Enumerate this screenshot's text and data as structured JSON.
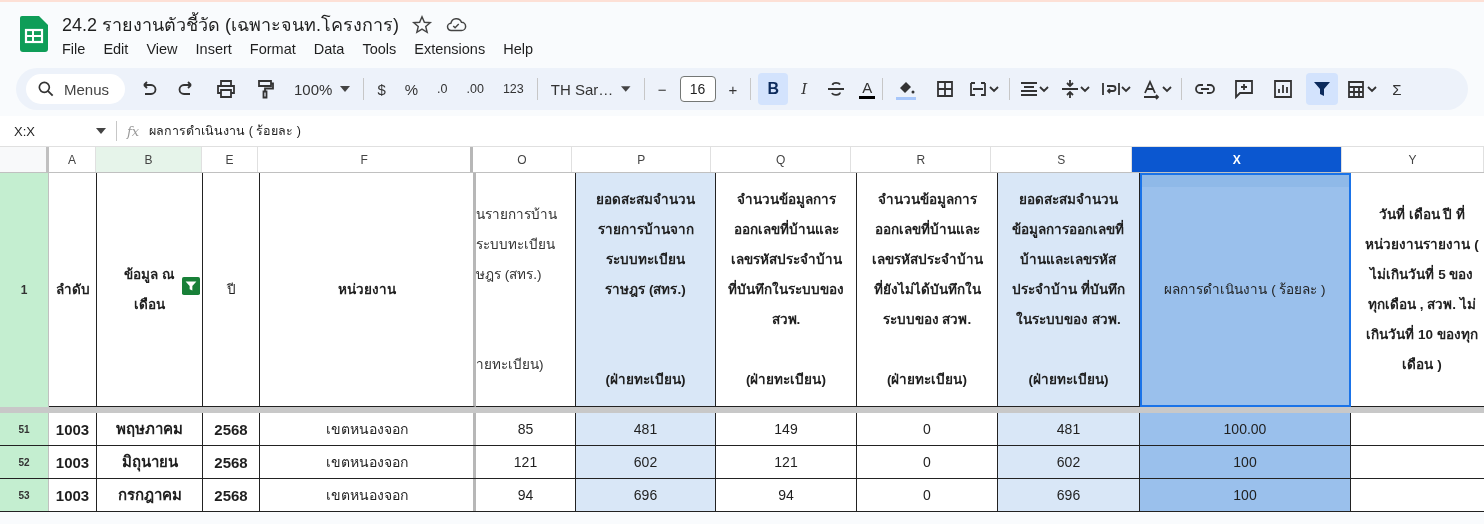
{
  "document": {
    "title": "24.2 รายงานตัวชี้วัด (เฉพาะจนท.โครงการ)",
    "starred": false
  },
  "menu": [
    "File",
    "Edit",
    "View",
    "Insert",
    "Format",
    "Data",
    "Tools",
    "Extensions",
    "Help"
  ],
  "toolbar": {
    "search_placeholder": "Menus",
    "zoom": "100%",
    "currency": "$",
    "percent": "%",
    "decimal_decrease": ".0",
    "decimal_increase": ".00",
    "number_format": "123",
    "font": "TH Sar…",
    "font_size": "16",
    "minus": "−",
    "plus": "+",
    "bold": {
      "label": "B",
      "on": true
    },
    "italic": {
      "label": "I"
    },
    "text_color": {
      "label": "A",
      "color": "#000000"
    },
    "fill_color": {
      "color": "#a8c7fa"
    },
    "filter_on": true,
    "sum": "Σ"
  },
  "formula_bar": {
    "name_box": "X:X",
    "fx": "fx",
    "value": "ผลการดำเนินงาน ( ร้อยละ )"
  },
  "columns": [
    {
      "letter": "A",
      "header": "ลำดับ",
      "bold": true,
      "selected": false,
      "highlighted": false,
      "filtered": false
    },
    {
      "letter": "B",
      "header": "ข้อมูล ณ\nเดือน",
      "bold": true,
      "selected": false,
      "highlighted": false,
      "filtered": true
    },
    {
      "letter": "E",
      "header": "ปี",
      "bold": false,
      "selected": false,
      "highlighted": false,
      "filtered": false
    },
    {
      "letter": "F",
      "header": "หน่วยงาน",
      "bold": true,
      "selected": false,
      "highlighted": false,
      "filtered": false
    },
    {
      "letter": "O",
      "header": "นรายการบ้าน\nระบบทะเบียน\nษฎร (สทร.)\n\n\nายทะเบียน)",
      "bold": false,
      "selected": false,
      "highlighted": false,
      "filtered": false
    },
    {
      "letter": "P",
      "header": "ยอดสะสมจำนวน\nรายการบ้านจาก\nระบบทะเบียน\nราษฎร (สทร.)\n\n\n(ฝ่ายทะเบียน)",
      "bold": true,
      "selected": false,
      "highlighted": true,
      "filtered": false
    },
    {
      "letter": "Q",
      "header": "จำนวนข้อมูลการ\nออกเลขที่บ้านและ\nเลขรหัสประจำบ้าน\nที่บันทึกในระบบของ\nสวพ.\n\n(ฝ่ายทะเบียน)",
      "bold": true,
      "selected": false,
      "highlighted": false,
      "filtered": false
    },
    {
      "letter": "R",
      "header": "จำนวนข้อมูลการ\nออกเลขที่บ้านและ\nเลขรหัสประจำบ้าน\nที่ยังไม่ได้บันทึกใน\nระบบของ สวพ.\n\n(ฝ่ายทะเบียน)",
      "bold": true,
      "selected": false,
      "highlighted": false,
      "filtered": false
    },
    {
      "letter": "S",
      "header": "ยอดสะสมจำนวน\nข้อมูลการออกเลขที่\nบ้านและเลขรหัส\nประจำบ้าน ที่บันทึก\nในระบบของ สวพ.\n\n(ฝ่ายทะเบียน)",
      "bold": true,
      "selected": false,
      "highlighted": true,
      "filtered": false
    },
    {
      "letter": "X",
      "header": "ผลการดำเนินงาน ( ร้อยละ )",
      "bold": false,
      "selected": true,
      "highlighted": false,
      "filtered": false
    },
    {
      "letter": "Y",
      "header": "วันที่ เดือน ปี ที่\nหน่วยงานรายงาน (\nไม่เกินวันที่ 5 ของ\nทุกเดือน , สวพ. ไม่\nเกินวันที่ 10 ของทุก\nเดือน )",
      "bold": true,
      "selected": false,
      "highlighted": false,
      "filtered": false
    }
  ],
  "header_row_number": "1",
  "rows": [
    {
      "number": "51",
      "cells": [
        "1003",
        "พฤษภาคม",
        "2568",
        "เขตหนองจอก",
        "85",
        "481",
        "149",
        "0",
        "481",
        "100.00"
      ]
    },
    {
      "number": "52",
      "cells": [
        "1003",
        "มิถุนายน",
        "2568",
        "เขตหนองจอก",
        "121",
        "602",
        "121",
        "0",
        "602",
        "100"
      ]
    },
    {
      "number": "53",
      "cells": [
        "1003",
        "กรกฎาคม",
        "2568",
        "เขตหนองจอก",
        "94",
        "696",
        "94",
        "0",
        "696",
        "100"
      ]
    }
  ]
}
